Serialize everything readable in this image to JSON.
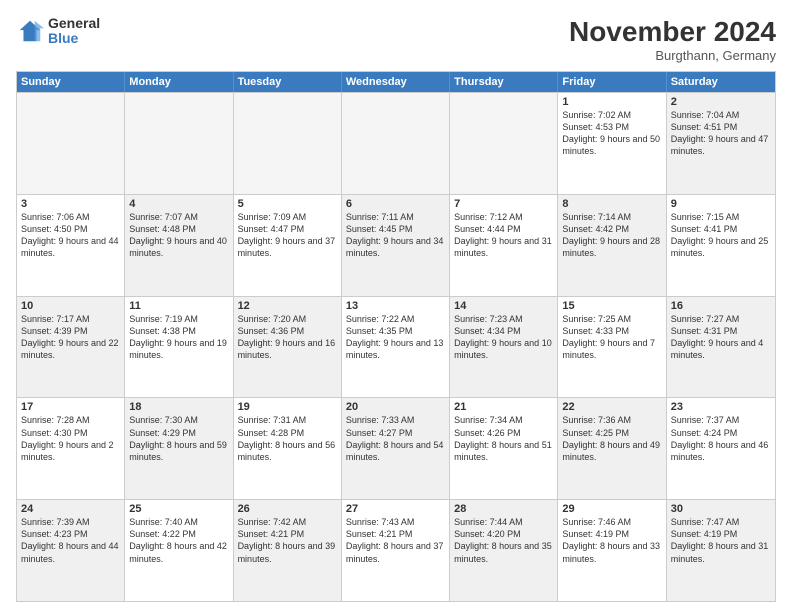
{
  "logo": {
    "general": "General",
    "blue": "Blue"
  },
  "title": "November 2024",
  "location": "Burgthann, Germany",
  "header_days": [
    "Sunday",
    "Monday",
    "Tuesday",
    "Wednesday",
    "Thursday",
    "Friday",
    "Saturday"
  ],
  "rows": [
    [
      {
        "day": "",
        "info": "",
        "empty": true
      },
      {
        "day": "",
        "info": "",
        "empty": true
      },
      {
        "day": "",
        "info": "",
        "empty": true
      },
      {
        "day": "",
        "info": "",
        "empty": true
      },
      {
        "day": "",
        "info": "",
        "empty": true
      },
      {
        "day": "1",
        "info": "Sunrise: 7:02 AM\nSunset: 4:53 PM\nDaylight: 9 hours\nand 50 minutes."
      },
      {
        "day": "2",
        "info": "Sunrise: 7:04 AM\nSunset: 4:51 PM\nDaylight: 9 hours\nand 47 minutes.",
        "shaded": true
      }
    ],
    [
      {
        "day": "3",
        "info": "Sunrise: 7:06 AM\nSunset: 4:50 PM\nDaylight: 9 hours\nand 44 minutes."
      },
      {
        "day": "4",
        "info": "Sunrise: 7:07 AM\nSunset: 4:48 PM\nDaylight: 9 hours\nand 40 minutes.",
        "shaded": true
      },
      {
        "day": "5",
        "info": "Sunrise: 7:09 AM\nSunset: 4:47 PM\nDaylight: 9 hours\nand 37 minutes."
      },
      {
        "day": "6",
        "info": "Sunrise: 7:11 AM\nSunset: 4:45 PM\nDaylight: 9 hours\nand 34 minutes.",
        "shaded": true
      },
      {
        "day": "7",
        "info": "Sunrise: 7:12 AM\nSunset: 4:44 PM\nDaylight: 9 hours\nand 31 minutes."
      },
      {
        "day": "8",
        "info": "Sunrise: 7:14 AM\nSunset: 4:42 PM\nDaylight: 9 hours\nand 28 minutes.",
        "shaded": true
      },
      {
        "day": "9",
        "info": "Sunrise: 7:15 AM\nSunset: 4:41 PM\nDaylight: 9 hours\nand 25 minutes."
      }
    ],
    [
      {
        "day": "10",
        "info": "Sunrise: 7:17 AM\nSunset: 4:39 PM\nDaylight: 9 hours\nand 22 minutes.",
        "shaded": true
      },
      {
        "day": "11",
        "info": "Sunrise: 7:19 AM\nSunset: 4:38 PM\nDaylight: 9 hours\nand 19 minutes."
      },
      {
        "day": "12",
        "info": "Sunrise: 7:20 AM\nSunset: 4:36 PM\nDaylight: 9 hours\nand 16 minutes.",
        "shaded": true
      },
      {
        "day": "13",
        "info": "Sunrise: 7:22 AM\nSunset: 4:35 PM\nDaylight: 9 hours\nand 13 minutes."
      },
      {
        "day": "14",
        "info": "Sunrise: 7:23 AM\nSunset: 4:34 PM\nDaylight: 9 hours\nand 10 minutes.",
        "shaded": true
      },
      {
        "day": "15",
        "info": "Sunrise: 7:25 AM\nSunset: 4:33 PM\nDaylight: 9 hours\nand 7 minutes."
      },
      {
        "day": "16",
        "info": "Sunrise: 7:27 AM\nSunset: 4:31 PM\nDaylight: 9 hours\nand 4 minutes.",
        "shaded": true
      }
    ],
    [
      {
        "day": "17",
        "info": "Sunrise: 7:28 AM\nSunset: 4:30 PM\nDaylight: 9 hours\nand 2 minutes."
      },
      {
        "day": "18",
        "info": "Sunrise: 7:30 AM\nSunset: 4:29 PM\nDaylight: 8 hours\nand 59 minutes.",
        "shaded": true
      },
      {
        "day": "19",
        "info": "Sunrise: 7:31 AM\nSunset: 4:28 PM\nDaylight: 8 hours\nand 56 minutes."
      },
      {
        "day": "20",
        "info": "Sunrise: 7:33 AM\nSunset: 4:27 PM\nDaylight: 8 hours\nand 54 minutes.",
        "shaded": true
      },
      {
        "day": "21",
        "info": "Sunrise: 7:34 AM\nSunset: 4:26 PM\nDaylight: 8 hours\nand 51 minutes."
      },
      {
        "day": "22",
        "info": "Sunrise: 7:36 AM\nSunset: 4:25 PM\nDaylight: 8 hours\nand 49 minutes.",
        "shaded": true
      },
      {
        "day": "23",
        "info": "Sunrise: 7:37 AM\nSunset: 4:24 PM\nDaylight: 8 hours\nand 46 minutes."
      }
    ],
    [
      {
        "day": "24",
        "info": "Sunrise: 7:39 AM\nSunset: 4:23 PM\nDaylight: 8 hours\nand 44 minutes.",
        "shaded": true
      },
      {
        "day": "25",
        "info": "Sunrise: 7:40 AM\nSunset: 4:22 PM\nDaylight: 8 hours\nand 42 minutes."
      },
      {
        "day": "26",
        "info": "Sunrise: 7:42 AM\nSunset: 4:21 PM\nDaylight: 8 hours\nand 39 minutes.",
        "shaded": true
      },
      {
        "day": "27",
        "info": "Sunrise: 7:43 AM\nSunset: 4:21 PM\nDaylight: 8 hours\nand 37 minutes."
      },
      {
        "day": "28",
        "info": "Sunrise: 7:44 AM\nSunset: 4:20 PM\nDaylight: 8 hours\nand 35 minutes.",
        "shaded": true
      },
      {
        "day": "29",
        "info": "Sunrise: 7:46 AM\nSunset: 4:19 PM\nDaylight: 8 hours\nand 33 minutes."
      },
      {
        "day": "30",
        "info": "Sunrise: 7:47 AM\nSunset: 4:19 PM\nDaylight: 8 hours\nand 31 minutes.",
        "shaded": true
      }
    ]
  ]
}
